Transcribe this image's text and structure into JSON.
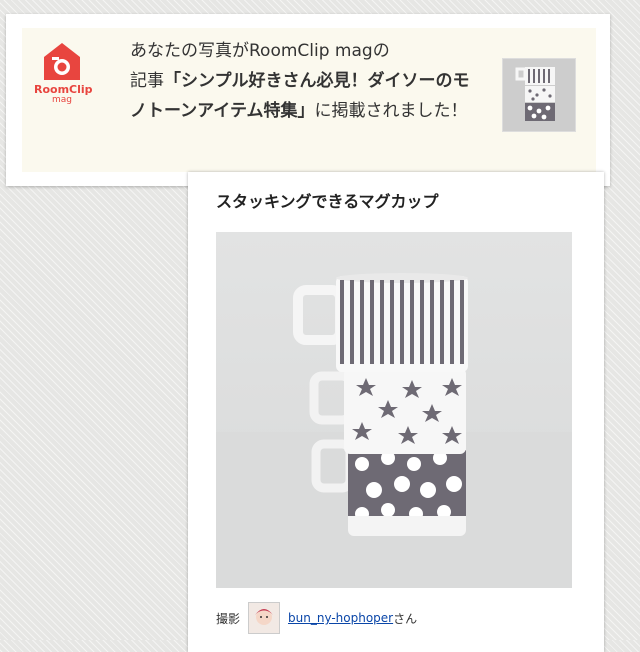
{
  "notice": {
    "logo_text": "RoomClip",
    "logo_sub": "mag",
    "text_prefix": "あなたの写真がRoomClip magの\n記事",
    "article_title": "「シンプル好きさん必見！ダイソーのモノトーンアイテム特集」",
    "text_suffix": "に掲載されました！"
  },
  "card": {
    "title": "スタッキングできるマグカップ",
    "credit_label": "撮影",
    "username": "bun_ny-hophoper",
    "username_suffix": "さん"
  },
  "colors": {
    "accent": "#e8453f",
    "link": "#0a46a8",
    "pattern": "#6e6a74"
  },
  "icons": {
    "logo": "roomclip-house-camera-icon"
  }
}
